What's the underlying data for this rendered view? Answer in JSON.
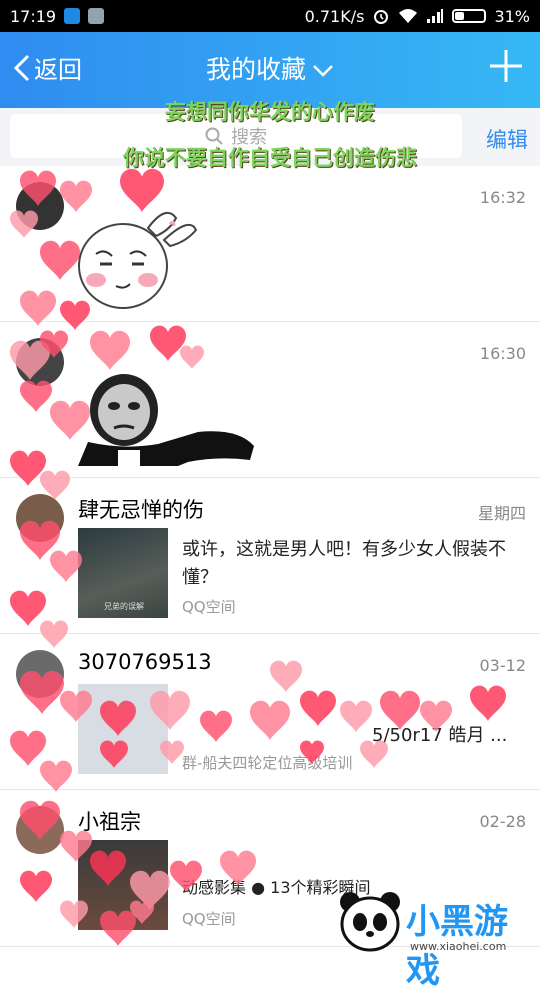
{
  "status_bar": {
    "time": "17:19",
    "net_speed": "0.71K/s",
    "battery": "31%",
    "battery_level": 0.31
  },
  "header": {
    "back_label": "返回",
    "title": "我的收藏"
  },
  "search": {
    "placeholder": "搜索",
    "edit_label": "编辑"
  },
  "overlay_lyrics": [
    "妄想同你华发的心作废",
    "你说不要自作自受自己创造伤悲"
  ],
  "items": [
    {
      "sender": "",
      "time": "16:32",
      "content": "",
      "source": ""
    },
    {
      "sender": "",
      "time": "16:30",
      "content": "",
      "source": ""
    },
    {
      "sender": "肆无忌惮的伤",
      "time": "星期四",
      "content": "或许，这就是男人吧！有多少女人假装不懂？",
      "source": "QQ空间",
      "thumb_caption": "兄弟的误解"
    },
    {
      "sender": "3070769513",
      "time": "03-12",
      "content": "5/50r17 皓月 ...",
      "source": "群-船夫四轮定位高级培训"
    },
    {
      "sender": "小祖宗",
      "time": "02-28",
      "content": "动感影集 ● 13个精彩瞬间",
      "source": "QQ空间"
    }
  ],
  "watermark": {
    "text": "小黑游戏",
    "url": "www.xiaohei.com"
  },
  "colors": {
    "accent": "#2f8cf0",
    "header_end": "#36b8f5",
    "lyrics": "#7cd65c",
    "heart": "#ff4f6d"
  }
}
